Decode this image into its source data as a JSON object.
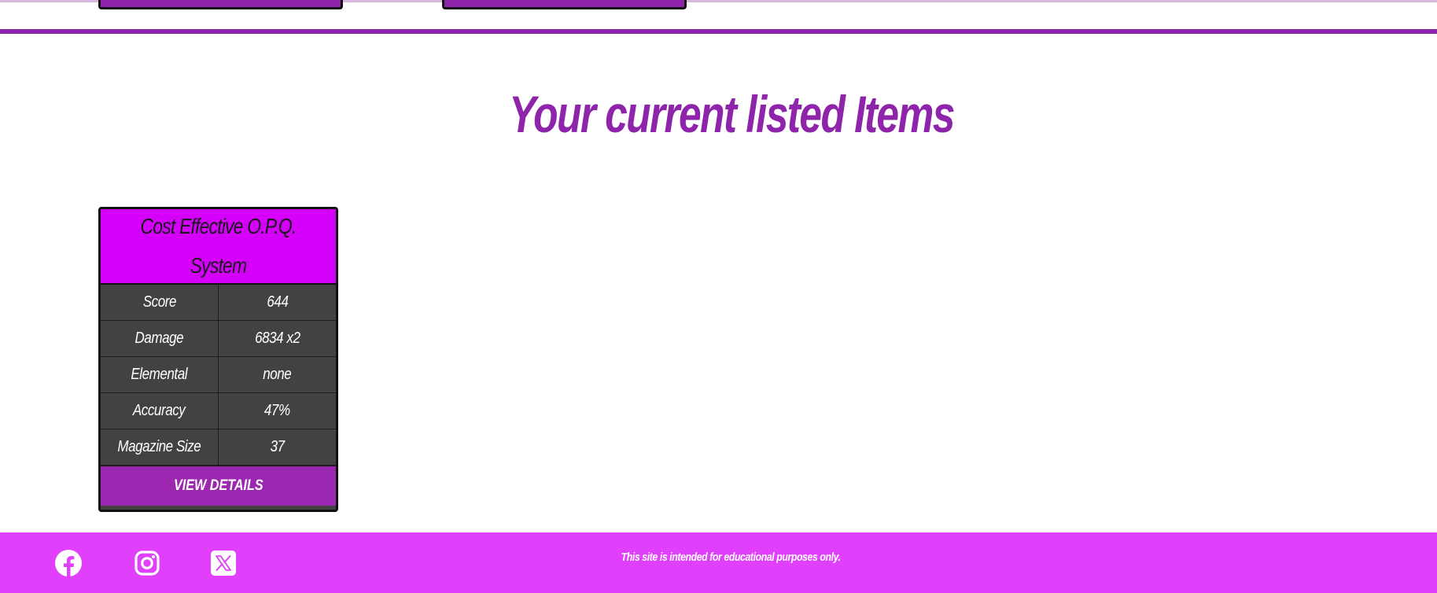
{
  "colors": {
    "accent_purple": "#8e24aa",
    "card_header": "#d500f9",
    "card_body": "#424242",
    "button": "#9c27b0",
    "footer": "#e040fb"
  },
  "section": {
    "title": "Your current listed Items"
  },
  "item": {
    "title": "Cost Effective O.P.Q. System",
    "stats": [
      {
        "label": "Score",
        "value": "644"
      },
      {
        "label": "Damage",
        "value": "6834 x2"
      },
      {
        "label": "Elemental",
        "value": "none"
      },
      {
        "label": "Accuracy",
        "value": "47%"
      },
      {
        "label": "Magazine Size",
        "value": "37"
      }
    ],
    "button_label": "VIEW DETAILS"
  },
  "footer": {
    "social_icons": [
      "facebook-icon",
      "instagram-icon",
      "x-icon"
    ],
    "note": "This site is intended for educational purposes only."
  }
}
